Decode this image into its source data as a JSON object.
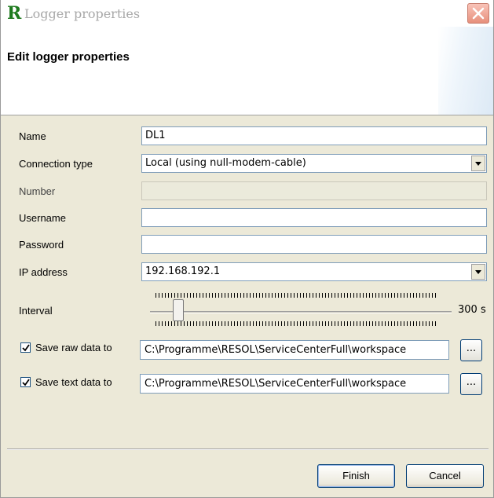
{
  "window": {
    "title": "Logger properties",
    "app_icon_letter": "R"
  },
  "header": {
    "title": "Edit logger properties"
  },
  "form": {
    "name_label": "Name",
    "name_value": "DL1",
    "connection_type_label": "Connection type",
    "connection_type_value": "Local (using null-modem-cable)",
    "number_label": "Number",
    "number_value": "",
    "username_label": "Username",
    "username_value": "",
    "password_label": "Password",
    "password_value": "",
    "ip_address_label": "IP address",
    "ip_address_value": "192.168.192.1",
    "interval_label": "Interval",
    "interval_value": "300 s",
    "save_raw_label": "Save raw data to",
    "save_raw_checked": true,
    "save_raw_path": "C:\\Programme\\RESOL\\ServiceCenterFull\\workspace",
    "save_text_label": "Save text data to",
    "save_text_checked": true,
    "save_text_path": "C:\\Programme\\RESOL\\ServiceCenterFull\\workspace",
    "browse_label": "..."
  },
  "buttons": {
    "finish": "Finish",
    "cancel": "Cancel"
  },
  "colors": {
    "dialog_background": "#ece9d8",
    "app_icon": "#1e7a1e",
    "close_button": "#e7907c"
  }
}
